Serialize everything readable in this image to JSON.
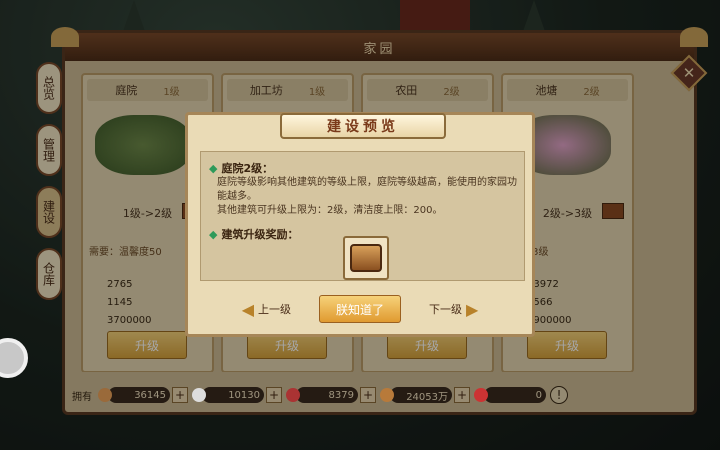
{
  "window_title": "家园",
  "tabs": [
    "总览",
    "管理",
    "建设",
    "仓库"
  ],
  "close_glyph": "✕",
  "cards": [
    {
      "name": "庭院",
      "level": "1级",
      "level_change": "1级->2级",
      "requirement": "需要：温馨度50",
      "res1": "2765",
      "res2": "1145",
      "res3": "3700000",
      "button": "升级"
    },
    {
      "name": "加工坊",
      "level": "1级",
      "level_change": "",
      "requirement": "",
      "res1": "",
      "res2": "",
      "res3": "",
      "button": "升级"
    },
    {
      "name": "农田",
      "level": "2级",
      "level_change": "",
      "requirement": "",
      "res1": "",
      "res2": "",
      "res3": "",
      "button": "升级"
    },
    {
      "name": "池塘",
      "level": "2级",
      "level_change": "2级->3级",
      "requirement": "庭院 3级",
      "res1": "13972",
      "res2": "9566",
      "res3": "5900000",
      "button": "升级"
    }
  ],
  "bottom": {
    "label": "拥有",
    "values": [
      "36145",
      "10130",
      "8379",
      "24053万",
      "0"
    ],
    "plus": "+",
    "alert": "!"
  },
  "modal": {
    "title": "建设预览",
    "section1": "庭院2级：",
    "desc1": "庭院等级影响其他建筑的等级上限，庭院等级越高，能使用的家园功能越多。",
    "desc2": "其他建筑可升级上限为：2级，清洁度上限：200。",
    "section2": "建筑升级奖励：",
    "prev": "上一级",
    "ok": "朕知道了",
    "next": "下一级"
  }
}
